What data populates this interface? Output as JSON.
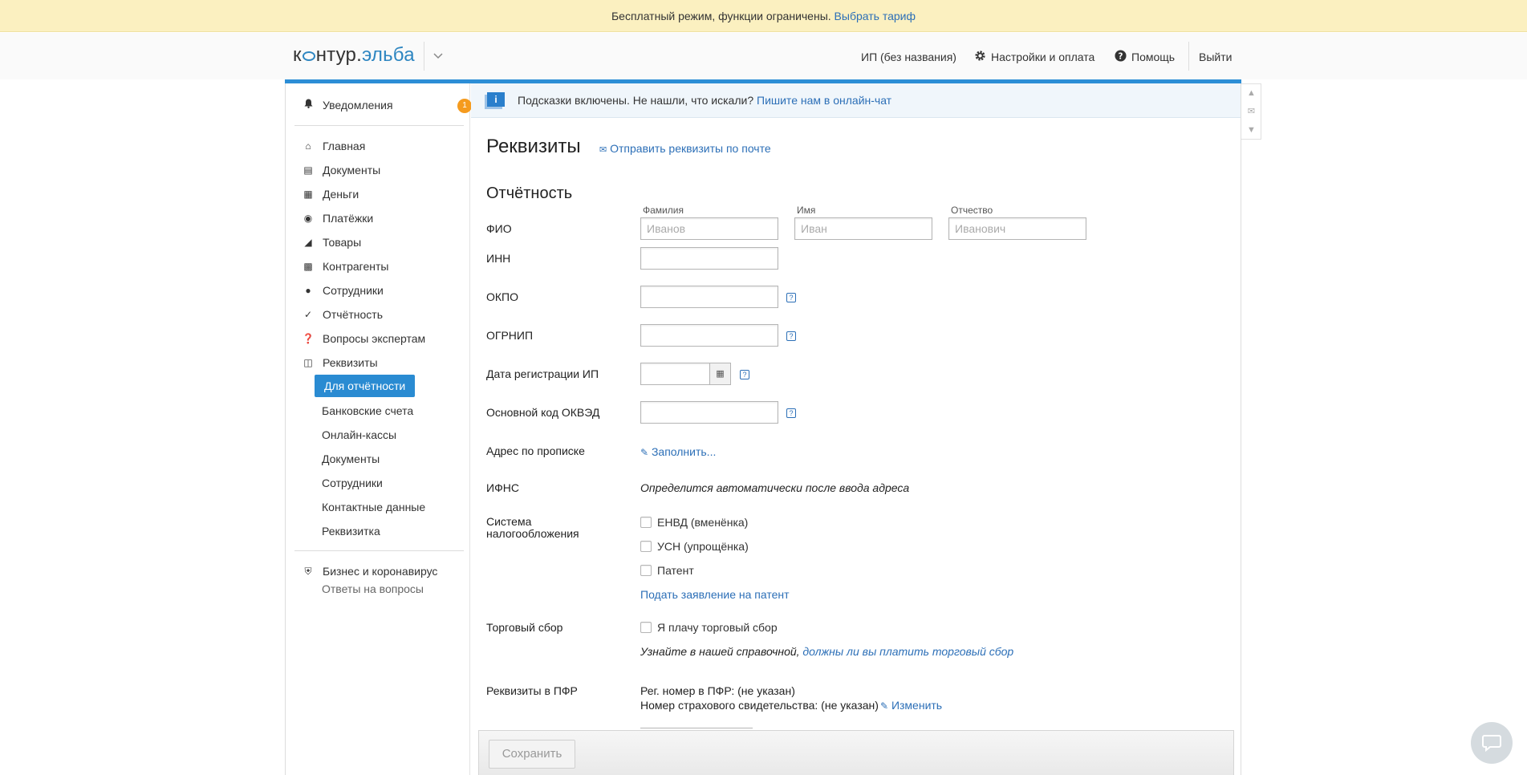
{
  "banner": {
    "text": "Бесплатный режим, функции ограничены.",
    "link": "Выбрать тариф"
  },
  "header": {
    "logo_left": "к",
    "logo_mid": "нтур.",
    "logo_right": "эльба",
    "org": "ИП (без названия)",
    "settings": "Настройки и оплата",
    "help": "Помощь",
    "logout": "Выйти"
  },
  "sidebar": {
    "notifications": "Уведомления",
    "notifications_count": "1",
    "items": [
      "Главная",
      "Документы",
      "Деньги",
      "Платёжки",
      "Товары",
      "Контрагенты",
      "Сотрудники",
      "Отчётность",
      "Вопросы экспертам",
      "Реквизиты"
    ],
    "sub": [
      "Для отчётности",
      "Банковские счета",
      "Онлайн-кассы",
      "Документы",
      "Сотрудники",
      "Контактные данные",
      "Реквизитка"
    ],
    "covid_title": "Бизнес и коронавирус",
    "covid_sub": "Ответы на вопросы"
  },
  "hints": {
    "text": "Подсказки включены. Не нашли, что искали?",
    "link": "Пишите нам в онлайн-чат"
  },
  "page": {
    "title": "Реквизиты",
    "send_link": "Отправить реквизиты по почте",
    "section": "Отчётность"
  },
  "form": {
    "fio_label": "ФИО",
    "surname_label": "Фамилия",
    "name_label": "Имя",
    "patronymic_label": "Отчество",
    "surname_ph": "Иванов",
    "name_ph": "Иван",
    "patronymic_ph": "Иванович",
    "inn_label": "ИНН",
    "okpo_label": "ОКПО",
    "ogrnip_label": "ОГРНИП",
    "regdate_label": "Дата регистрации ИП",
    "okved_label": "Основной код ОКВЭД",
    "address_label": "Адрес по прописке",
    "address_link": "Заполнить...",
    "ifns_label": "ИФНС",
    "ifns_value": "Определится автоматически после ввода адреса",
    "tax_label_1": "Система",
    "tax_label_2": "налогообложения",
    "tax_envd": "ЕНВД (вменёнка)",
    "tax_usn": "УСН (упрощёнка)",
    "tax_patent": "Патент",
    "patent_link": "Подать заявление на патент",
    "trade_label": "Торговый сбор",
    "trade_check": "Я плачу торговый сбор",
    "trade_note": "Узнайте в нашей справочной,",
    "trade_note_link": "должны ли вы платить торговый сбор",
    "pfr_label": "Реквизиты в ПФР",
    "pfr_reg": "Рег. номер в ПФР: (не указан)",
    "pfr_cert": "Номер страхового свидетельства: (не указан)",
    "pfr_change": "Изменить"
  },
  "save_label": "Сохранить",
  "colors": {
    "accent": "#2a8bd2",
    "banner": "#fbf0c0",
    "badge": "#f59b1e"
  }
}
